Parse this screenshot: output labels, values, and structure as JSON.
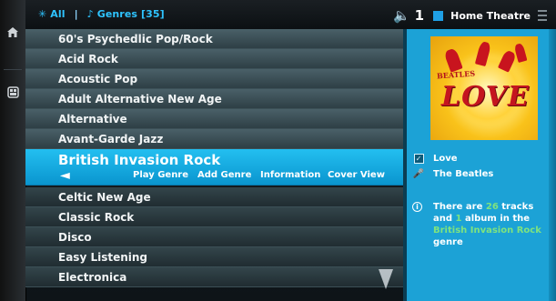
{
  "header": {
    "all_label": "All",
    "genres_label": "Genres [35]",
    "zone_count": "1",
    "zone_name": "Home Theatre"
  },
  "genres": [
    "60's Psychedlic Pop/Rock",
    "Acid Rock",
    "Acoustic Pop",
    "Adult Alternative New Age",
    "Alternative",
    "Avant-Garde Jazz",
    "British Invasion Rock",
    "Celtic New Age",
    "Classic Rock",
    "Disco",
    "Easy Listening",
    "Electronica"
  ],
  "selected_index": 6,
  "actions": {
    "back": "◄",
    "play": "Play Genre",
    "add": "Add Genre",
    "info": "Information",
    "cover": "Cover View"
  },
  "details": {
    "album_art_brand": "BEATLES",
    "album_art_title": "LOVE",
    "album": "Love",
    "artist": "The Beatles",
    "info_pre": "There are",
    "tracks": "26",
    "info_mid": "tracks and",
    "albums": "1",
    "info_mid2": "album in the",
    "genre": "British Invasion Rock",
    "info_post": "genre"
  },
  "icons": {
    "home": "home-icon",
    "panel": "panel-icon",
    "scroll_down": "scroll-down-arrow-icon"
  },
  "colors": {
    "accent": "#1ca2d6",
    "highlight": "#7fe37f",
    "header_text": "#2ec4ff"
  }
}
